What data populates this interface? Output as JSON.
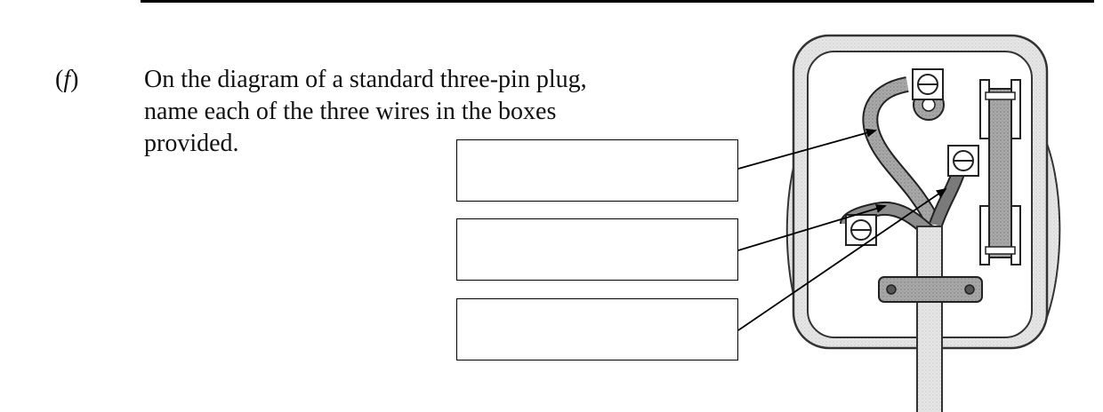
{
  "question": {
    "part_open": "(",
    "part_letter": "f",
    "part_close": ")",
    "lines": [
      "On the diagram of a standard three-pin plug,",
      "name each of the three wires in the boxes",
      "provided."
    ]
  },
  "answer_boxes": [
    {
      "value": ""
    },
    {
      "value": ""
    },
    {
      "value": ""
    }
  ],
  "colors": {
    "ink": "#000000",
    "plug_shading": "#d9d9d9",
    "wire_shading": "#9c9c9c",
    "fuse_shading": "#b8b8b8",
    "cord_grip": "#6e6e6e"
  }
}
